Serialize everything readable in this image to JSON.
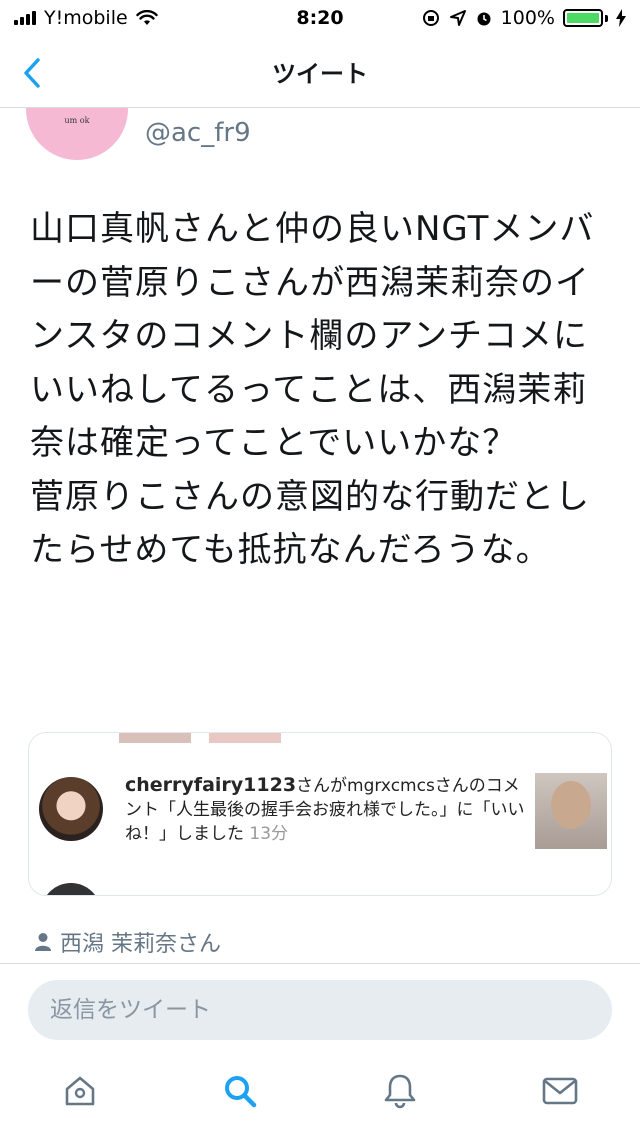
{
  "status_bar": {
    "carrier": "Y!mobile",
    "time": "8:20",
    "battery": "100%"
  },
  "nav": {
    "title": "ツイート"
  },
  "tweet": {
    "avatar_text": "um ok",
    "handle": "@ac_fr9",
    "text": "山口真帆さんと仲の良いNGTメンバーの菅原りこさんが西潟茉莉奈のインスタのコメント欄のアンチコメにいいねしてるってことは、西潟茉莉奈は確定ってことでいいかな？\n菅原りこさんの意図的な行動だとしたらせめても抵抗なんだろうな。"
  },
  "media_card": {
    "username": "cherryfairy1123",
    "notification_text": "さんがmgrxcmcsさんのコメント「人生最後の握手会お疲れ様でした。」に「いいね！」しました",
    "time": "13分"
  },
  "liked_by": {
    "text": "西潟 茉莉奈さん"
  },
  "reply": {
    "placeholder": "返信をツイート"
  },
  "tab_bar": {
    "icons": [
      "home-icon",
      "search-icon",
      "notifications-icon",
      "messages-icon"
    ],
    "active": "search-icon",
    "active_color": "#1da1f2",
    "inactive_color": "#657786"
  },
  "colors": {
    "accent": "#1da1f2",
    "battery_fill": "#4cd964"
  }
}
